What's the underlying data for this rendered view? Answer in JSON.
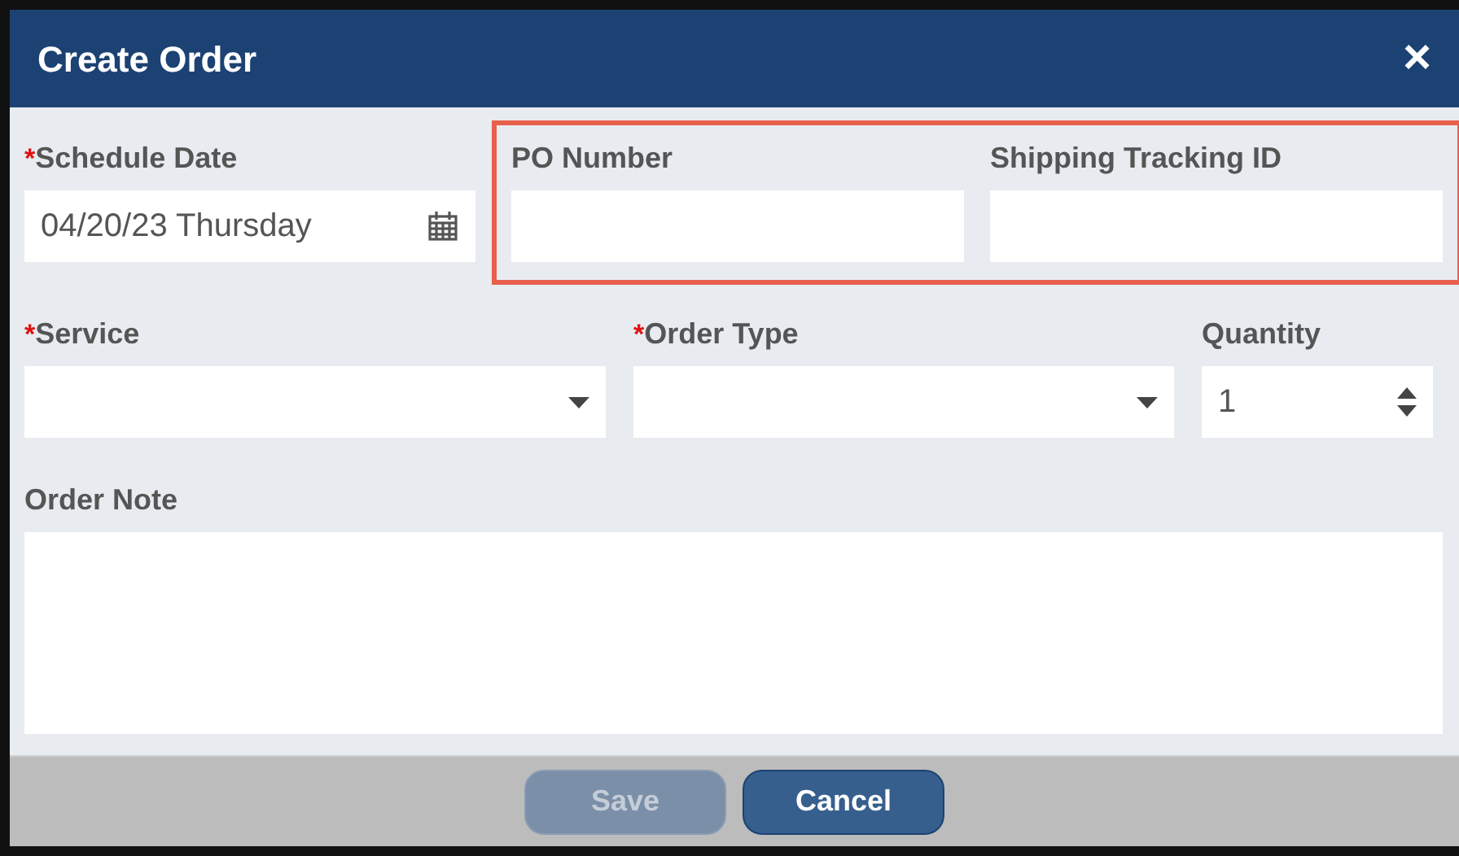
{
  "dialog": {
    "title": "Create Order",
    "close": "×"
  },
  "date_field": {
    "mark": "*",
    "label": "Schedule Date",
    "kind": "date",
    "value": "04/20/23 Thursday"
  },
  "highlighted_fields": [
    {
      "label": "PO Number",
      "kind": "text"
    },
    {
      "label": "Shipping Tracking ID",
      "kind": "text"
    }
  ],
  "row_fields": [
    {
      "mark": "*",
      "label": "Service",
      "kind": "select"
    },
    {
      "mark": "*",
      "label": "Order Type",
      "kind": "select"
    },
    {
      "label": "Quantity",
      "kind": "number",
      "value": "1"
    }
  ],
  "note_field": {
    "label": "Order Note",
    "kind": "textarea"
  },
  "buttons": [
    {
      "label": "Save",
      "disabled": true
    },
    {
      "label": "Cancel",
      "disabled": false
    }
  ]
}
